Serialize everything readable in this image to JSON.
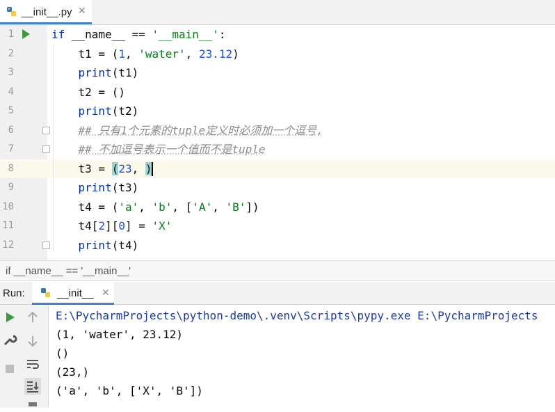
{
  "editor_tab": {
    "filename": "__init__.py",
    "close": "✕"
  },
  "code_lines": [
    {
      "num": "1",
      "segments": [
        {
          "t": "if ",
          "c": "kw"
        },
        {
          "t": "__name__ == ",
          "c": ""
        },
        {
          "t": "'__main__'",
          "c": "str"
        },
        {
          "t": ":",
          "c": ""
        }
      ]
    },
    {
      "num": "2",
      "segments": [
        {
          "t": "    t1 = (",
          "c": ""
        },
        {
          "t": "1",
          "c": "num"
        },
        {
          "t": ", ",
          "c": ""
        },
        {
          "t": "'water'",
          "c": "str"
        },
        {
          "t": ", ",
          "c": ""
        },
        {
          "t": "23.12",
          "c": "num"
        },
        {
          "t": ")",
          "c": ""
        }
      ]
    },
    {
      "num": "3",
      "segments": [
        {
          "t": "    ",
          "c": ""
        },
        {
          "t": "print",
          "c": "kw"
        },
        {
          "t": "(t1)",
          "c": ""
        }
      ]
    },
    {
      "num": "4",
      "segments": [
        {
          "t": "    t2 = ()",
          "c": ""
        }
      ]
    },
    {
      "num": "5",
      "segments": [
        {
          "t": "    ",
          "c": ""
        },
        {
          "t": "print",
          "c": "kw"
        },
        {
          "t": "(t2)",
          "c": ""
        }
      ]
    },
    {
      "num": "6",
      "segments": [
        {
          "t": "    ",
          "c": ""
        },
        {
          "t": "## 只有1个元素的tuple定义时必须加一个逗号,",
          "c": "cmt"
        }
      ]
    },
    {
      "num": "7",
      "segments": [
        {
          "t": "    ",
          "c": ""
        },
        {
          "t": "## 不加逗号表示一个值而不是tuple",
          "c": "cmt"
        }
      ]
    },
    {
      "num": "8",
      "segments": [
        {
          "t": "    t3 = ",
          "c": ""
        },
        {
          "t": "(",
          "c": "brace-hl"
        },
        {
          "t": "23",
          "c": "num"
        },
        {
          "t": ", ",
          "c": ""
        },
        {
          "t": ")",
          "c": "brace-hl"
        },
        {
          "t": "",
          "c": "caret"
        }
      ]
    },
    {
      "num": "9",
      "segments": [
        {
          "t": "    ",
          "c": ""
        },
        {
          "t": "print",
          "c": "kw"
        },
        {
          "t": "(t3)",
          "c": ""
        }
      ]
    },
    {
      "num": "10",
      "segments": [
        {
          "t": "    t4 = (",
          "c": ""
        },
        {
          "t": "'a'",
          "c": "str"
        },
        {
          "t": ", ",
          "c": ""
        },
        {
          "t": "'b'",
          "c": "str"
        },
        {
          "t": ", [",
          "c": ""
        },
        {
          "t": "'A'",
          "c": "str"
        },
        {
          "t": ", ",
          "c": ""
        },
        {
          "t": "'B'",
          "c": "str"
        },
        {
          "t": "])",
          "c": ""
        }
      ]
    },
    {
      "num": "11",
      "segments": [
        {
          "t": "    t4[",
          "c": ""
        },
        {
          "t": "2",
          "c": "num"
        },
        {
          "t": "][",
          "c": ""
        },
        {
          "t": "0",
          "c": "num"
        },
        {
          "t": "] = ",
          "c": ""
        },
        {
          "t": "'X'",
          "c": "str"
        }
      ]
    },
    {
      "num": "12",
      "segments": [
        {
          "t": "    ",
          "c": ""
        },
        {
          "t": "print",
          "c": "kw"
        },
        {
          "t": "(t4)",
          "c": ""
        }
      ]
    }
  ],
  "breadcrumb": "if __name__ == '__main__'",
  "run_panel": {
    "label": "Run:",
    "tab_label": "__init__",
    "close": "✕"
  },
  "console_output": [
    "E:\\PycharmProjects\\python-demo\\.venv\\Scripts\\pypy.exe E:\\PycharmProjects",
    "(1, 'water', 23.12)",
    "()",
    "(23,)",
    "('a', 'b', ['X', 'B'])"
  ],
  "colors": {
    "accent": "#4083c9",
    "run_green": "#3a9a3a",
    "keyword": "#0033b3",
    "string": "#067d17",
    "number": "#1750eb",
    "comment": "#8c8c8c"
  },
  "icons": {
    "tab_file": "python-file-icon",
    "run": "run-icon",
    "wrench": "wrench-icon",
    "stop": "stop-icon",
    "up": "up-arrow-icon",
    "down": "down-arrow-icon",
    "wrap": "soft-wrap-icon",
    "scroll": "scroll-to-end-icon"
  }
}
